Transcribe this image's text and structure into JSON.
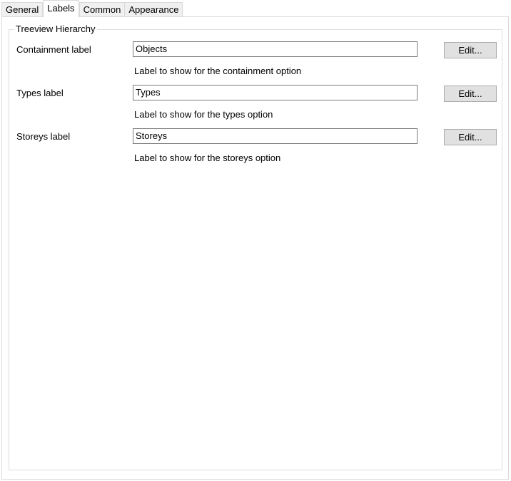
{
  "tabs": [
    {
      "label": "General"
    },
    {
      "label": "Labels"
    },
    {
      "label": "Common"
    },
    {
      "label": "Appearance"
    }
  ],
  "active_tab": "Labels",
  "group": {
    "title": "Treeview Hierarchy",
    "rows": [
      {
        "label": "Containment label",
        "value": "Objects",
        "button": "Edit...",
        "hint": "Label to show for the containment option"
      },
      {
        "label": "Types label",
        "value": "Types",
        "button": "Edit...",
        "hint": "Label to show for the types option"
      },
      {
        "label": "Storeys label",
        "value": "Storeys",
        "button": "Edit...",
        "hint": "Label to show for the storeys option"
      }
    ]
  }
}
